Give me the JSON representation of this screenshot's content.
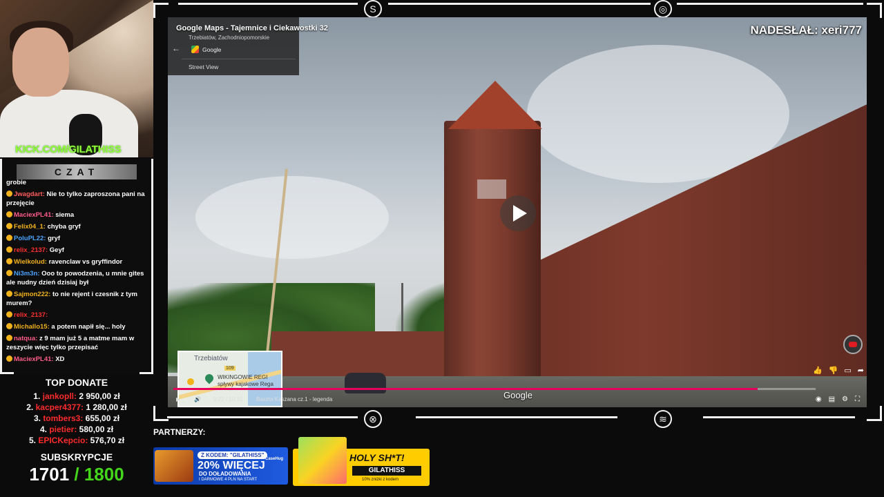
{
  "stream": {
    "channel_url": "KICK.COM/GILATHISS",
    "chat_header": "CZAT",
    "submitter": "NADESŁAŁ: xeri777"
  },
  "chat": {
    "messages": [
      {
        "user": "",
        "text": "grobie",
        "color": "#ffffff"
      },
      {
        "user": "Jwagdart:",
        "text": "Nie to tylko zaproszona pani na przejęcie",
        "color": "#ff5c5c"
      },
      {
        "user": "MaciexPL41:",
        "text": "siema",
        "color": "#ff5c8a"
      },
      {
        "user": "Felix04_1:",
        "text": "chyba gryf",
        "color": "#f2b21b"
      },
      {
        "user": "PoluPL22:",
        "text": "gryf",
        "color": "#4aa3ff"
      },
      {
        "user": "relix_2137:",
        "text": "Geyf",
        "color": "#ff3030"
      },
      {
        "user": "Wielkolud:",
        "text": "ravenclaw vs gryffindor",
        "color": "#f2b21b"
      },
      {
        "user": "Ni3m3n:",
        "text": "Ooo to powodzenia, u mnie gites ale nudny dzień dzisiaj był",
        "color": "#4aa3ff"
      },
      {
        "user": "Sajmon222:",
        "text": "to nie rejent i czesnik z tym murem?",
        "color": "#f2b21b"
      },
      {
        "user": "relix_2137:",
        "text": "",
        "color": "#ff3030"
      },
      {
        "user": "Michallo15:",
        "text": "a potem napił się... holy",
        "color": "#f2b21b"
      },
      {
        "user": "natqua:",
        "text": "z 9 mam już 5 a matme mam w zeszycie więc tylko przepisać",
        "color": "#ff5c8a"
      },
      {
        "user": "MaciexPL41:",
        "text": "XD",
        "color": "#ff5c8a"
      }
    ]
  },
  "donate": {
    "title": "TOP DONATE",
    "rows": [
      {
        "rank": "1.",
        "name": "jankopll:",
        "amount": "2 950,00 zł"
      },
      {
        "rank": "2.",
        "name": "kacper4377:",
        "amount": "1 280,00 zł"
      },
      {
        "rank": "3.",
        "name": "tombers3:",
        "amount": "655,00 zł"
      },
      {
        "rank": "4.",
        "name": "pietier:",
        "amount": "580,00 zł"
      },
      {
        "rank": "5.",
        "name": "EPICKepcio:",
        "amount": "576,70 zł"
      }
    ]
  },
  "subs": {
    "title": "SUBSKRYPCJE",
    "count": "1701",
    "goal": "/ 1800"
  },
  "video": {
    "title": "Google Maps - Tajemnice i Ciekawostki 32",
    "location": "Trzebiatów, Zachodniopomorskie",
    "provider": "Google",
    "mode": "Street View",
    "watermark": "Google",
    "time": "9:22 / 10:15",
    "chapter": "Baszta Kaszana cz.1 - legenda",
    "progress_fraction": 0.91
  },
  "minimap": {
    "city": "Trzebiatów",
    "place": "WIKINGOWIE REGI spływy kajakowe Rega",
    "road": "109"
  },
  "partners": {
    "label": "PARTNERZY:",
    "ad1": {
      "code": "Z KODEM: \"GILATHISS\"",
      "brand": "CaseHug",
      "headline": "20% WIĘCEJ",
      "sub": "DO DOŁADOWANIA",
      "fine": "I DARMOWE 4 PLN NA START"
    },
    "ad2": {
      "headline": "HOLY SH*T!",
      "code": "GILATHISS",
      "fine": "10% zniżki z kodem"
    }
  }
}
